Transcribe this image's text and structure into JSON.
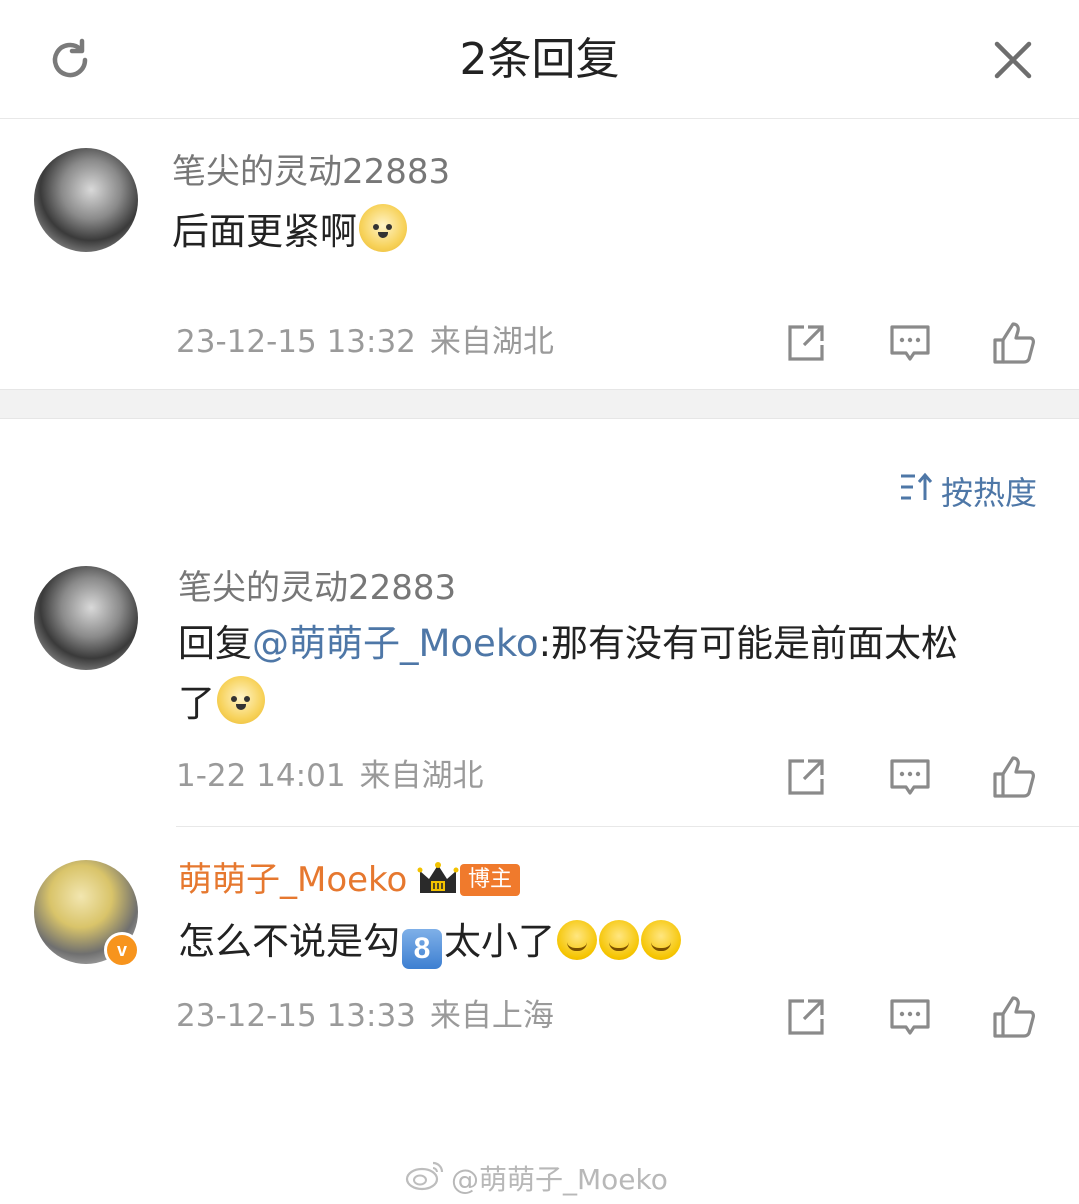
{
  "header": {
    "title": "2条回复"
  },
  "root_comment": {
    "username": "笔尖的灵动22883",
    "text": "后面更紧啊",
    "time": "23-12-15 13:32",
    "location": "来自湖北"
  },
  "sort": {
    "label": "按热度"
  },
  "replies": [
    {
      "username": "笔尖的灵动22883",
      "reply_prefix": "回复",
      "mention": "@萌萌子_Moeko",
      "text_line1": ":那有没有可能是前面太松",
      "text_line2": "了",
      "time": "1-22 14:01",
      "location": "来自湖北"
    },
    {
      "username": "萌萌子_Moeko",
      "badge": "博主",
      "verified_mark": "v",
      "text_a": "怎么不说是勾",
      "keycap": "8",
      "text_b": "太小了",
      "time": "23-12-15 13:33",
      "location": "来自上海"
    }
  ],
  "watermark": {
    "text": "@萌萌子_Moeko"
  },
  "colors": {
    "accent_blue": "#4e77a7",
    "blogger_orange": "#e6782f",
    "badge_orange": "#f07a2c",
    "meta_gray": "#9a9a9a"
  },
  "icons": [
    "refresh-icon",
    "close-icon",
    "share-icon",
    "comment-icon",
    "like-icon",
    "sort-icon",
    "crown-badge-icon",
    "weibo-logo-icon"
  ]
}
